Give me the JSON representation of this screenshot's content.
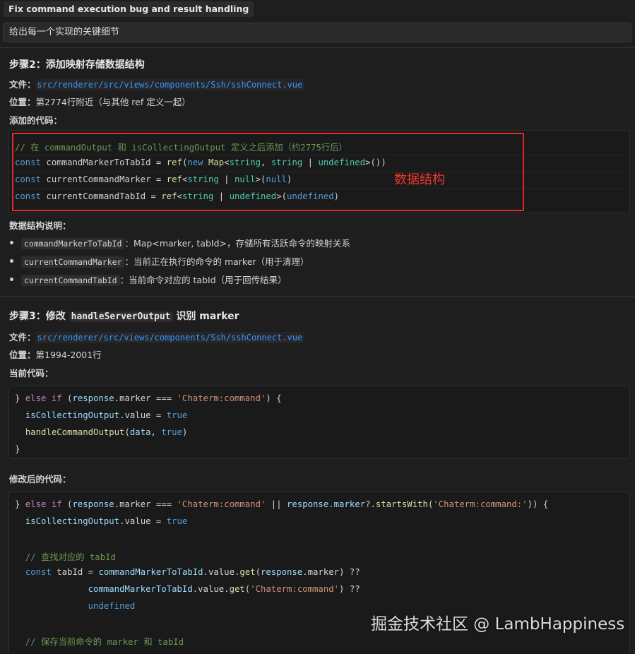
{
  "header": {
    "title": "Fix command execution bug and result handling"
  },
  "prompt": {
    "text": "给出每一个实现的关键细节"
  },
  "step2": {
    "heading": "步骤2：添加映射存储数据结构",
    "file_label": "文件：",
    "file_path": "src/renderer/src/views/components/Ssh/sshConnect.vue",
    "pos_label": "位置：",
    "pos_value": "第2774行附近（与其他 ref 定义一起）",
    "code_label": "添加的代码：",
    "annotation": "数据结构",
    "desc_label": "数据结构说明：",
    "bullets": [
      {
        "code": "commandMarkerToTabId",
        "text": "：Map<marker, tabId>，存储所有活跃命令的映射关系"
      },
      {
        "code": "currentCommandMarker",
        "text": "：当前正在执行的命令的 marker（用于清理）"
      },
      {
        "code": "currentCommandTabId",
        "text": "：当前命令对应的 tabId（用于回传结果）"
      }
    ]
  },
  "step3": {
    "heading_prefix": "步骤3：修改 ",
    "heading_code": "handleServerOutput",
    "heading_suffix": " 识别 marker",
    "file_label": "文件：",
    "file_path": "src/renderer/src/views/components/Ssh/sshConnect.vue",
    "pos_label": "位置：",
    "pos_value": "第1994-2001行",
    "current_label": "当前代码：",
    "modified_label": "修改后的代码："
  },
  "code1": {
    "l1": "// 在 commandOutput 和 isCollectingOutput 定义之后添加（约2775行后）",
    "l2": [
      "const",
      " commandMarkerToTabId = ",
      "ref",
      "(",
      "new",
      " ",
      "Map",
      "<",
      "string",
      ", ",
      "string",
      " | ",
      "undefined",
      ">())"
    ],
    "l3": [
      "const",
      " currentCommandMarker = ",
      "ref",
      "<",
      "string",
      " | ",
      "null",
      ">(",
      "null",
      ")"
    ],
    "l4": [
      "const",
      " currentCommandTabId = ",
      "ref",
      "<",
      "string",
      " | ",
      "undefined",
      ">(",
      "undefined",
      ")"
    ]
  },
  "code2": {
    "l1": [
      "} ",
      "else if",
      " (",
      "response",
      ".marker === ",
      "'Chaterm:command'",
      ") {"
    ],
    "l2": [
      "  ",
      "isCollectingOutput",
      ".value = ",
      "true"
    ],
    "l3": [
      "  ",
      "handleCommandOutput",
      "(",
      "data",
      ", ",
      "true",
      ")"
    ],
    "l4": "}"
  },
  "code3": {
    "l1": [
      "} ",
      "else if",
      " (",
      "response",
      ".marker === ",
      "'Chaterm:command'",
      " || ",
      "response",
      ".",
      "marker",
      "?.",
      "startsWith",
      "(",
      "'Chaterm:command:'",
      ")) {"
    ],
    "l2": [
      "  ",
      "isCollectingOutput",
      ".value = ",
      "true"
    ],
    "l3": "  // 查找对应的 tabId",
    "l4": [
      "  ",
      "const",
      " tabId = ",
      "commandMarkerToTabId",
      ".value.",
      "get",
      "(",
      "response",
      ".marker) ??"
    ],
    "l5": [
      "              ",
      "commandMarkerToTabId",
      ".value.",
      "get",
      "(",
      "'Chaterm:command'",
      ") ??"
    ],
    "l6": [
      "              ",
      "undefined"
    ],
    "l7": "  // 保存当前命令的 marker 和 tabId"
  },
  "watermark": "掘金技术社区 @ LambHappiness",
  "colors": {
    "accent_red": "#e52828",
    "link_blue": "#3794ff",
    "keyword": "#569cd6",
    "string": "#ce9178",
    "comment": "#6a9955",
    "type": "#4ec9b0"
  }
}
